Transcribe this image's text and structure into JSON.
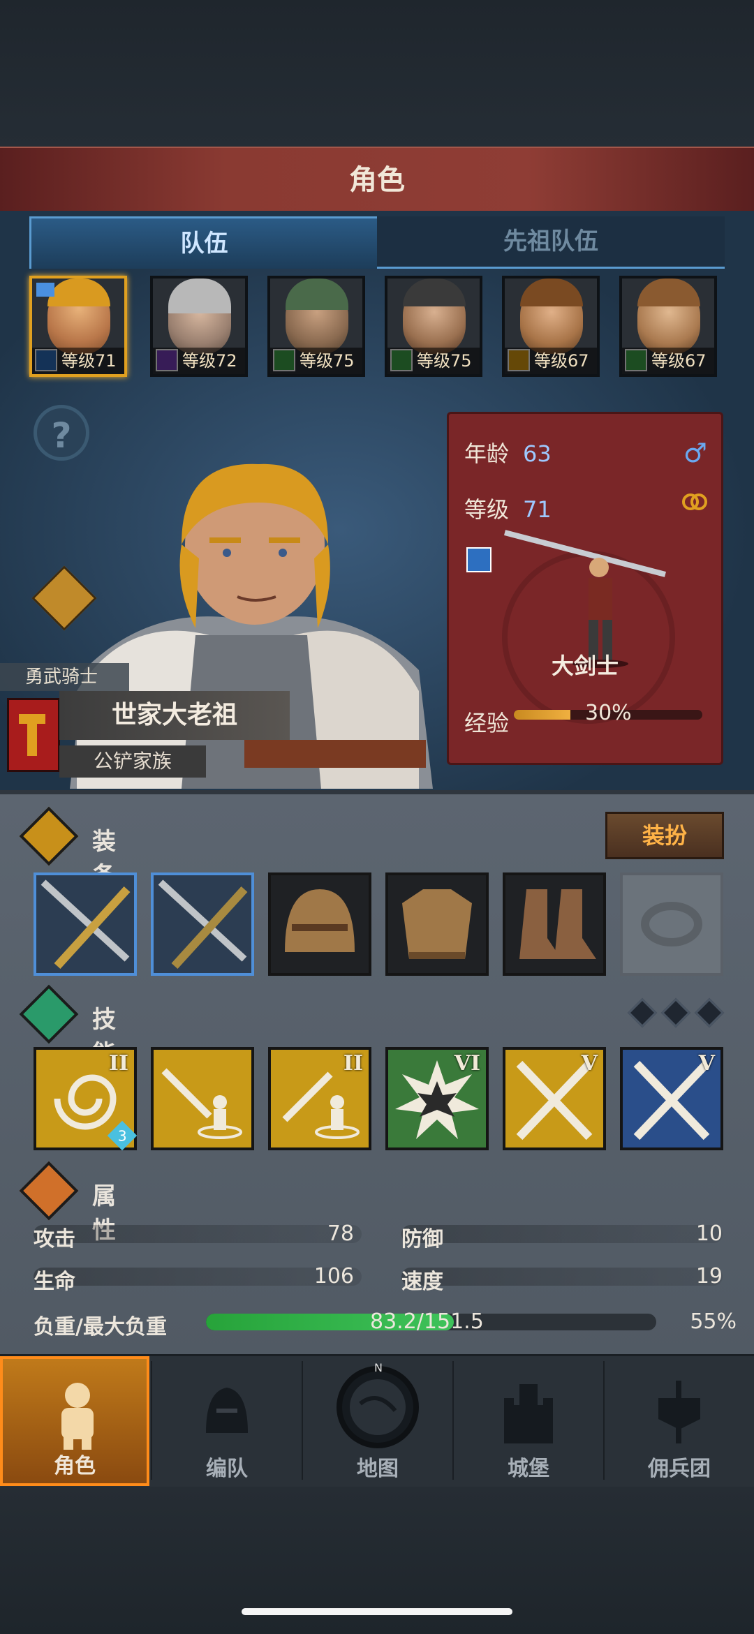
{
  "header": {
    "title": "角色"
  },
  "tabs": [
    {
      "label": "队伍",
      "active": true
    },
    {
      "label": "先祖队伍",
      "active": false
    }
  ],
  "party": [
    {
      "level_text": "等级71",
      "class_color": "#2d6fc0",
      "selected": true,
      "flag": true
    },
    {
      "level_text": "等级72",
      "class_color": "#7a3fc0",
      "star": true
    },
    {
      "level_text": "等级75",
      "class_color": "#3fa84a",
      "star": true
    },
    {
      "level_text": "等级75",
      "class_color": "#3fa84a"
    },
    {
      "level_text": "等级67",
      "class_color": "#e0a010"
    },
    {
      "level_text": "等级67",
      "class_color": "#3fa84a"
    }
  ],
  "character": {
    "title_tag": "勇武骑士",
    "name": "世家大老祖",
    "family": "公铲家族",
    "age_label": "年龄",
    "age": "63",
    "level_label": "等级",
    "level": "71",
    "class_name": "大剑士",
    "exp_label": "经验",
    "exp_percent_text": "30%",
    "exp_fraction": 0.3,
    "gender_icon": "male-icon",
    "ring_icon": "marriage-rings-icon"
  },
  "equipment": {
    "label": "装备",
    "dress_button": "装扮",
    "slots": [
      "greatsword-icon",
      "greatsword-icon",
      "helmet-icon",
      "armor-icon",
      "boots-icon",
      "ring-icon"
    ]
  },
  "skills": {
    "label": "技能",
    "items": [
      {
        "icon": "whirlwind-icon",
        "rank": "II",
        "bg": "#c89a18",
        "badge": "3"
      },
      {
        "icon": "sword-guard-icon",
        "rank": "",
        "bg": "#c89a18"
      },
      {
        "icon": "sword-guard-icon",
        "rank": "II",
        "bg": "#c89a18"
      },
      {
        "icon": "impact-icon",
        "rank": "VI",
        "bg": "#3a7a3a"
      },
      {
        "icon": "crossed-swords-icon",
        "rank": "V",
        "bg": "#c89a18"
      },
      {
        "icon": "crossed-swords-icon",
        "rank": "V",
        "bg": "#2a4e8a"
      }
    ]
  },
  "attributes": {
    "label": "属性",
    "attack_label": "攻击",
    "attack": "78",
    "defense_label": "防御",
    "defense": "10",
    "hp_label": "生命",
    "hp": "106",
    "speed_label": "速度",
    "speed": "19",
    "load_label": "负重/最大负重",
    "load_text": "83.2/151.5",
    "load_percent": "55%",
    "load_fraction": 0.55
  },
  "nav": [
    {
      "label": "角色",
      "icon": "knight-icon",
      "active": true
    },
    {
      "label": "编队",
      "icon": "formation-helmet-icon"
    },
    {
      "label": "地图",
      "icon": "compass-map-icon"
    },
    {
      "label": "城堡",
      "icon": "castle-icon"
    },
    {
      "label": "佣兵团",
      "icon": "mercenary-banner-icon"
    }
  ]
}
